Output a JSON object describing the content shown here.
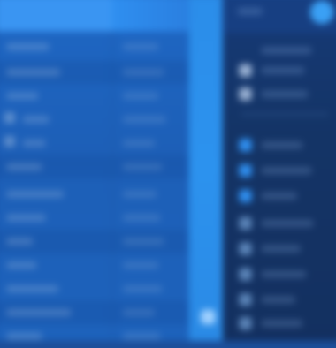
{
  "header": {
    "active_tab_label": "",
    "secondary_label": ""
  },
  "left_list": {
    "rows": [
      {
        "label": "",
        "value": ""
      },
      {
        "label": "",
        "value": ""
      },
      {
        "label": "",
        "value": ""
      },
      {
        "label": "",
        "value": ""
      },
      {
        "label": "",
        "value": ""
      },
      {
        "label": "",
        "value": ""
      },
      {
        "label": "",
        "value": ""
      },
      {
        "label": "",
        "value": ""
      },
      {
        "label": "",
        "value": ""
      },
      {
        "label": "",
        "value": ""
      },
      {
        "label": "",
        "value": ""
      },
      {
        "label": "",
        "value": ""
      },
      {
        "label": "",
        "value": ""
      }
    ]
  },
  "dark_panel": {
    "title": "",
    "items": [
      {
        "label": "",
        "icon": "app-icon"
      },
      {
        "label": "",
        "icon": "app-icon"
      },
      {
        "label": "",
        "icon": "app-icon"
      },
      {
        "label": "",
        "icon": "app-icon"
      },
      {
        "label": "",
        "icon": "app-icon"
      },
      {
        "label": "",
        "icon": "app-icon"
      },
      {
        "label": "",
        "icon": "app-icon"
      },
      {
        "label": "",
        "icon": "app-icon"
      },
      {
        "label": "",
        "icon": "app-icon"
      },
      {
        "label": "",
        "icon": "app-icon"
      },
      {
        "label": "",
        "icon": "app-icon"
      }
    ]
  },
  "colors": {
    "panel_blue": "#1e67c4",
    "header_blue": "#2f8ff0",
    "scroll_blue": "#2c92ee",
    "dark_navy": "#143466",
    "accent": "#3aa0f5"
  }
}
